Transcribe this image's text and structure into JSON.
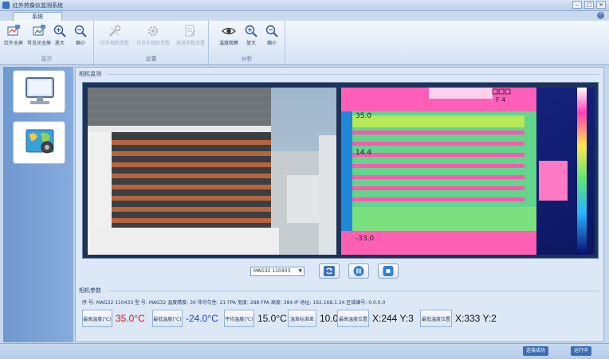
{
  "window": {
    "title": "红外热像仪监测系统"
  },
  "ribbon": {
    "tab_label": "系统",
    "groups": [
      {
        "label": "显示",
        "buttons": [
          {
            "label": "红外全屏",
            "icon": "thermal-fullscreen-icon"
          },
          {
            "label": "可见光全屏",
            "icon": "visible-fullscreen-icon"
          },
          {
            "label": "放大",
            "icon": "zoom-in-icon"
          },
          {
            "label": "缩小",
            "icon": "zoom-out-icon"
          }
        ]
      },
      {
        "label": "设置",
        "buttons": [
          {
            "label": "红外相机参数",
            "icon": "tools-icon"
          },
          {
            "label": "可见光相机参数",
            "icon": "gear-icon"
          },
          {
            "label": "测温参数设置",
            "icon": "document-icon"
          }
        ]
      },
      {
        "label": "分析",
        "buttons": [
          {
            "label": "温度观察",
            "icon": "eye-icon"
          },
          {
            "label": "放大",
            "icon": "zoom-in-icon"
          },
          {
            "label": "缩小",
            "icon": "zoom-out-icon"
          }
        ]
      }
    ]
  },
  "nav": {
    "items": [
      {
        "icon": "monitor-icon"
      },
      {
        "icon": "map-icon"
      }
    ]
  },
  "monitor": {
    "title": "相机监测",
    "thermal": {
      "scale_top": "35.0",
      "scale_mid": "14.4",
      "scale_bottom": "-33.0",
      "corner_label": "F 4"
    },
    "camera_select": "MAG32 110433",
    "controls": [
      {
        "icon": "refresh-icon"
      },
      {
        "icon": "pause-icon"
      },
      {
        "icon": "stop-icon"
      }
    ]
  },
  "camera_info": {
    "title": "相机参数",
    "line": "序    号: MAG32 110433   型    号: MAG32   温度精度: 30   非均匀性: 21   FPA 宽度: 288   FPA 高度: 384   IP 地址: 192.168.1.34   区域编号: 0.0.0.0",
    "measurements": [
      {
        "label": "最高温度(℃)",
        "value": "35.0°C",
        "color": "#e01414"
      },
      {
        "label": "最低温度(℃)",
        "value": "-24.0°C",
        "color": "#1a3fd6"
      },
      {
        "label": "平均温度(℃)",
        "value": "15.0°C",
        "color": "#111111"
      },
      {
        "label": "温差标准差",
        "value": "10.0",
        "color": "#111111"
      },
      {
        "label": "最高温度位置",
        "value": "X:244 Y:3",
        "color": "#111111"
      },
      {
        "label": "最低温度位置",
        "value": "X:333 Y:2",
        "color": "#111111"
      }
    ]
  },
  "status": {
    "left": "连接成功",
    "right": "运行中"
  }
}
